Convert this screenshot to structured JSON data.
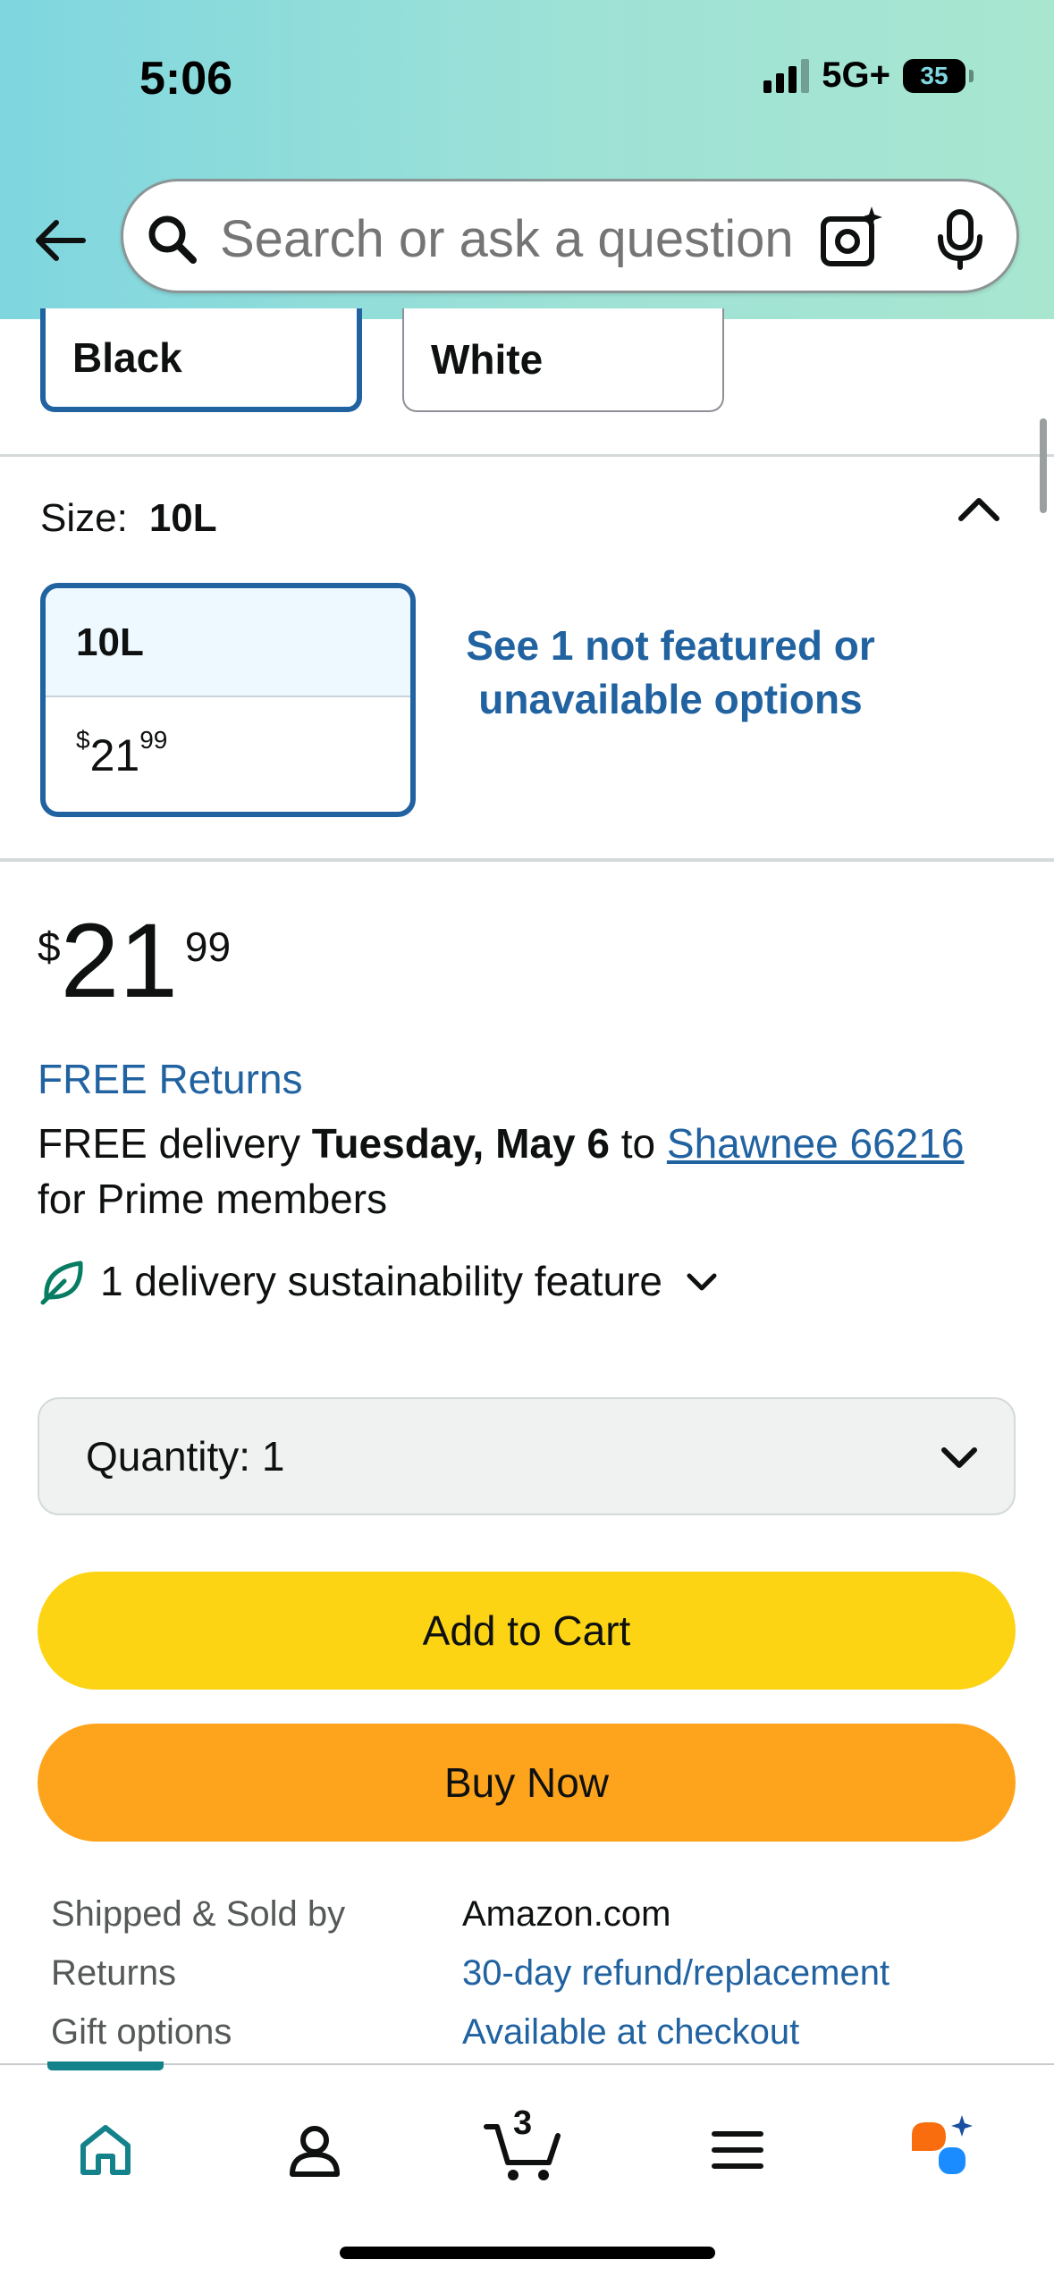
{
  "status_bar": {
    "time": "5:06",
    "network": "5G+",
    "battery": "35"
  },
  "header": {
    "search_placeholder": "Search or ask a question"
  },
  "colors": {
    "options": [
      "Black",
      "White"
    ],
    "selected": "Black"
  },
  "size": {
    "label": "Size:",
    "selected": "10L",
    "option": {
      "name": "10L",
      "price_currency": "$",
      "price_whole": "21",
      "price_fraction": "99"
    },
    "not_featured_link": "See 1 not featured or unavailable options"
  },
  "price": {
    "currency": "$",
    "whole": "21",
    "fraction": "99"
  },
  "returns": "FREE Returns",
  "delivery": {
    "prefix": "FREE delivery",
    "date": "Tuesday, May 6",
    "to": "to",
    "location": "Shawnee 66216",
    "suffix": "for Prime members"
  },
  "sustainability": "1 delivery sustainability feature",
  "quantity": {
    "label": "Quantity:",
    "value": "1"
  },
  "buttons": {
    "add_to_cart": "Add to Cart",
    "buy_now": "Buy Now"
  },
  "seller_info": [
    {
      "key": "Shipped & Sold by",
      "value": "Amazon.com",
      "link": false
    },
    {
      "key": "Returns",
      "value": "30-day refund/replacement",
      "link": true
    },
    {
      "key": "Gift options",
      "value": "Available at checkout",
      "link": true
    }
  ],
  "tabbar": {
    "cart_count": "3",
    "active": "home"
  },
  "accent_colors": {
    "link": "#2162a1",
    "add_to_cart": "#fcd414",
    "buy_now": "#fea41c",
    "active_tab": "#13828a"
  }
}
